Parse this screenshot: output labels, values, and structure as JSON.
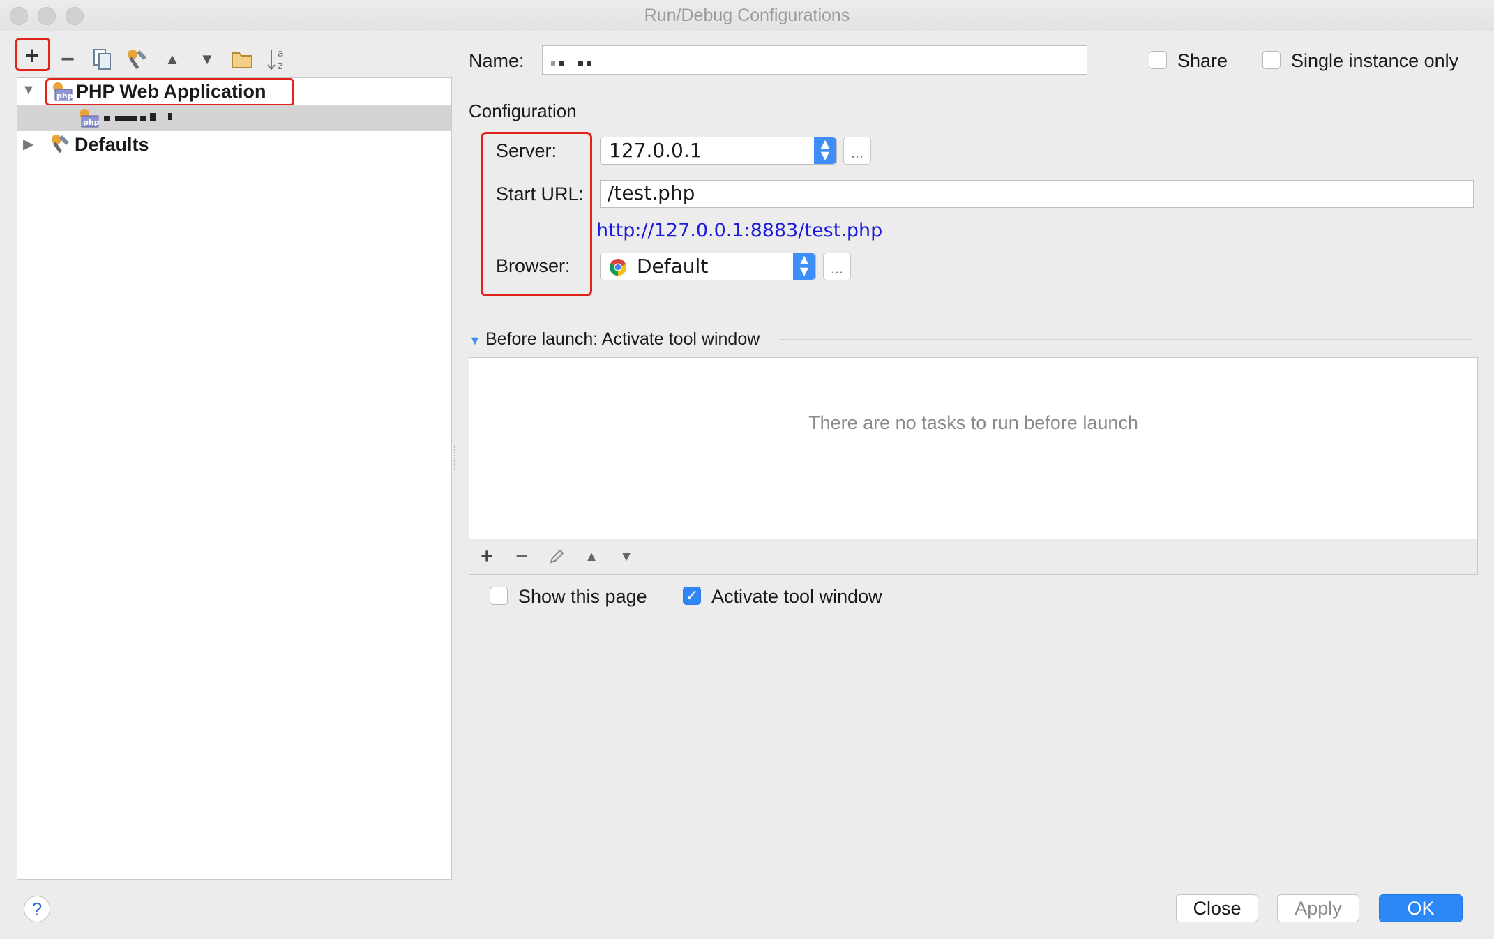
{
  "window": {
    "title": "Run/Debug Configurations"
  },
  "toolbar": {
    "add_label": "+",
    "remove_label": "−"
  },
  "tree": {
    "items": [
      {
        "label": "PHP Web Application"
      },
      {
        "label": ""
      },
      {
        "label": "Defaults"
      }
    ]
  },
  "form": {
    "name_label": "Name:",
    "name_value": "",
    "share_label": "Share",
    "single_instance_label": "Single instance only",
    "configuration_label": "Configuration",
    "server_label": "Server:",
    "server_value": "127.0.0.1",
    "start_url_label": "Start URL:",
    "start_url_value": "/test.php",
    "resolved_url": "http://127.0.0.1:8883/test.php",
    "browser_label": "Browser:",
    "browser_value": "Default",
    "dots_label": "..."
  },
  "before_launch": {
    "title": "Before launch: Activate tool window",
    "empty_text": "There are no tasks to run before launch",
    "show_page_label": "Show this page",
    "activate_label": "Activate tool window"
  },
  "footer": {
    "help_label": "?",
    "close_label": "Close",
    "apply_label": "Apply",
    "ok_label": "OK"
  },
  "colors": {
    "highlight": "#e0241c",
    "accent": "#2c87f7",
    "link": "#1a1adb"
  }
}
